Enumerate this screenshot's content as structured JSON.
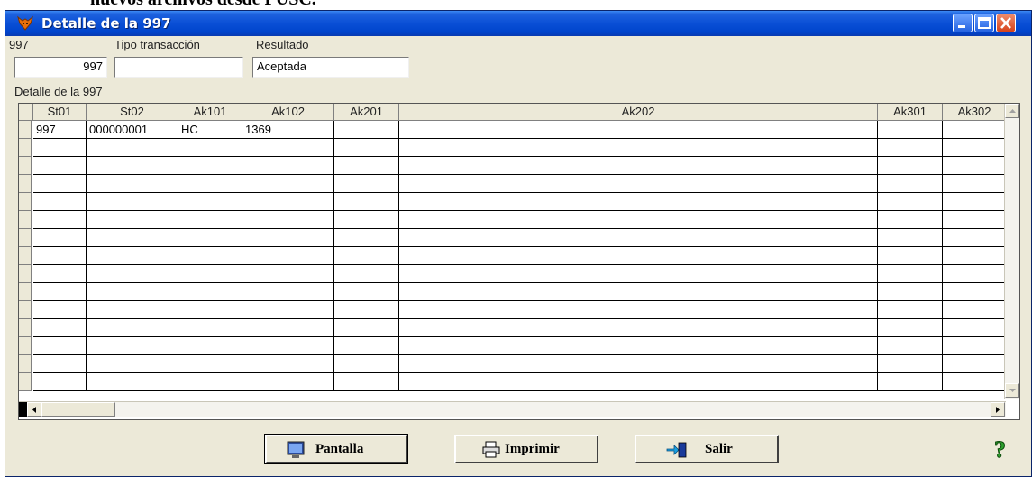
{
  "background_text": "nuevos archivos desde PUSC.",
  "window": {
    "title": "Detalle de la 997"
  },
  "form": {
    "field1": {
      "label": "997",
      "value": "997"
    },
    "field2": {
      "label": "Tipo transacción",
      "value": ""
    },
    "field3": {
      "label": "Resultado",
      "value": "Aceptada"
    }
  },
  "grid": {
    "label": "Detalle de la 997",
    "columns": [
      "St01",
      "St02",
      "Ak101",
      "Ak102",
      "Ak201",
      "Ak202",
      "Ak301",
      "Ak302"
    ],
    "rows": [
      [
        "997",
        "000000001",
        "HC",
        "1369",
        "",
        "",
        "",
        ""
      ]
    ],
    "empty_rows": 14
  },
  "buttons": {
    "pantalla": "Pantalla",
    "imprimir": "Imprimir",
    "salir": "Salir"
  },
  "colors": {
    "titlebar": "#0a4fd6",
    "window_bg": "#ece9d8",
    "help_icon": "#2ea02e"
  }
}
